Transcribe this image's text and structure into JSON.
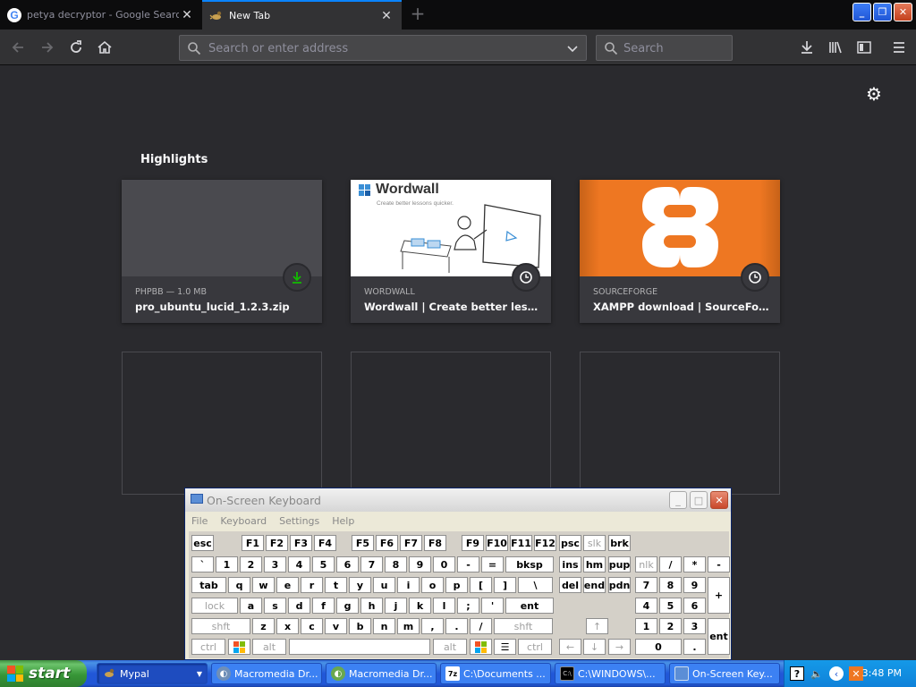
{
  "browser": {
    "tabs": [
      {
        "title": "petya decryptor - Google Search",
        "favicon": "google-g-icon",
        "active": false
      },
      {
        "title": "New Tab",
        "favicon": "mypal-icon",
        "active": true
      }
    ],
    "urlbar": {
      "value": "",
      "placeholder": "Search or enter address"
    },
    "searchbar": {
      "value": "",
      "placeholder": "Search"
    }
  },
  "newtab": {
    "highlights_title": "Highlights",
    "cards": [
      {
        "source": "PHPBB — 1.0 MB",
        "title": "pro_ubuntu_lucid_1.2.3.zip",
        "badge": "download-icon",
        "thumb": "blank"
      },
      {
        "source": "WORDWALL",
        "title": "Wordwall | Create better lesson…",
        "badge": "history-clock-icon",
        "thumb": "wordwall",
        "thumb_logo": "Wordwall",
        "thumb_tagline": "Create better lessons quicker."
      },
      {
        "source": "SOURCEFORGE",
        "title": "XAMPP download | SourceForg…",
        "badge": "history-clock-icon",
        "thumb": "xampp"
      }
    ]
  },
  "osk": {
    "title": "On-Screen Keyboard",
    "menu": [
      "File",
      "Keyboard",
      "Settings",
      "Help"
    ],
    "rows": {
      "fn": [
        "esc",
        "F1",
        "F2",
        "F3",
        "F4",
        "F5",
        "F6",
        "F7",
        "F8",
        "F9",
        "F10",
        "F11",
        "F12",
        "psc",
        "slk",
        "brk"
      ],
      "num": [
        "`",
        "1",
        "2",
        "3",
        "4",
        "5",
        "6",
        "7",
        "8",
        "9",
        "0",
        "-",
        "=",
        "bksp",
        "ins",
        "hm",
        "pup",
        "nlk",
        "/",
        "*",
        "-"
      ],
      "top": [
        "tab",
        "q",
        "w",
        "e",
        "r",
        "t",
        "y",
        "u",
        "i",
        "o",
        "p",
        "[",
        "]",
        "\\",
        "del",
        "end",
        "pdn",
        "7",
        "8",
        "9",
        "+"
      ],
      "home": [
        "lock",
        "a",
        "s",
        "d",
        "f",
        "g",
        "h",
        "j",
        "k",
        "l",
        ";",
        "'",
        "ent",
        "4",
        "5",
        "6"
      ],
      "shift": [
        "shft",
        "z",
        "x",
        "c",
        "v",
        "b",
        "n",
        "m",
        ",",
        ".",
        "/",
        "shft",
        "1",
        "2",
        "3",
        "ent"
      ],
      "bottom": [
        "ctrl",
        "alt",
        "alt",
        "ctrl",
        "0",
        "."
      ]
    }
  },
  "taskbar": {
    "start_label": "start",
    "tasks": [
      {
        "label": "Mypal",
        "icon": "mypal-icon",
        "active": true
      },
      {
        "label": "Macromedia Dr...",
        "icon": "dreamweaver-icon",
        "active": false
      },
      {
        "label": "Macromedia Dr...",
        "icon": "dreamweaver-green-icon",
        "active": false
      },
      {
        "label": "C:\\Documents ...",
        "icon": "7zip-icon",
        "active": false
      },
      {
        "label": "C:\\WINDOWS\\...",
        "icon": "cmd-icon",
        "active": false
      },
      {
        "label": "On-Screen Key...",
        "icon": "keyboard-icon",
        "active": false
      }
    ],
    "clock": "3:48 PM"
  },
  "colors": {
    "accent": "#0a84ff",
    "download_green": "#12bc00",
    "xampp_orange": "#ee7722"
  }
}
